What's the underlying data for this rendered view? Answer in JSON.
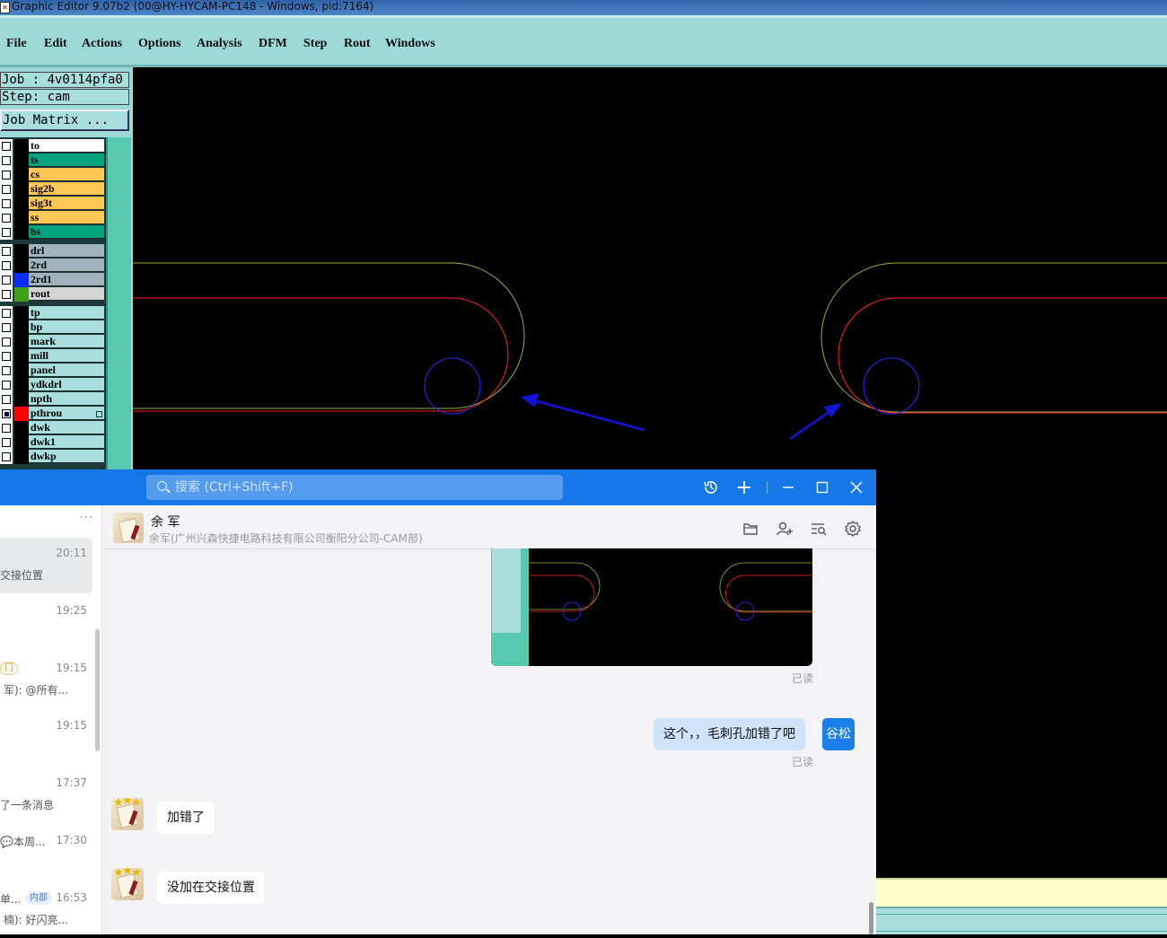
{
  "editor": {
    "title": "Graphic Editor 9.07b2 (00@HY-HYCAM-PC148 - Windows, pid:7164)",
    "menu": [
      "File",
      "Edit",
      "Actions",
      "Options",
      "Analysis",
      "DFM",
      "Step",
      "Rout",
      "Windows"
    ],
    "job_label": "Job : 4v0114pfa0",
    "step_label": "Step: cam",
    "job_matrix_button": "Job Matrix ...",
    "layers": [
      {
        "name": "to",
        "color": "#ffffff",
        "swatch": "#000000"
      },
      {
        "name": "ts",
        "color": "#00a37e",
        "swatch": "#000000"
      },
      {
        "name": "cs",
        "color": "#ffc756",
        "swatch": "#000000"
      },
      {
        "name": "sig2b",
        "color": "#ffc756",
        "swatch": "#000000"
      },
      {
        "name": "sig3t",
        "color": "#ffc756",
        "swatch": "#000000"
      },
      {
        "name": "ss",
        "color": "#ffc756",
        "swatch": "#000000"
      },
      {
        "name": "bs",
        "color": "#00a37e",
        "swatch": "#000000"
      },
      {
        "name": "drl",
        "color": "#9fb4be",
        "swatch": "#000000"
      },
      {
        "name": "2rd",
        "color": "#9fb4be",
        "swatch": "#000000"
      },
      {
        "name": "2rd1",
        "color": "#9fb4be",
        "swatch": "#0b2bff"
      },
      {
        "name": "rout",
        "color": "#d4d4d4",
        "swatch": "#3fa015"
      },
      {
        "name": "tp",
        "color": "#a8dedd",
        "swatch": "#000000"
      },
      {
        "name": "bp",
        "color": "#a8dedd",
        "swatch": "#000000"
      },
      {
        "name": "mark",
        "color": "#a8dedd",
        "swatch": "#000000"
      },
      {
        "name": "mill",
        "color": "#a8dedd",
        "swatch": "#000000"
      },
      {
        "name": "panel",
        "color": "#a8dedd",
        "swatch": "#000000"
      },
      {
        "name": "ydkdrl",
        "color": "#a8dedd",
        "swatch": "#000000"
      },
      {
        "name": "npth",
        "color": "#a8dedd",
        "swatch": "#000000"
      },
      {
        "name": "pthrou",
        "color": "#a8dedd",
        "swatch": "#ff0000"
      },
      {
        "name": "dwk",
        "color": "#a8dedd",
        "swatch": "#000000"
      },
      {
        "name": "dwk1",
        "color": "#a8dedd",
        "swatch": "#000000"
      },
      {
        "name": "dwkp",
        "color": "#a8dedd",
        "swatch": "#000000"
      }
    ],
    "colors": {
      "outline_green": "#8fb43a",
      "outline_red": "#ff2020",
      "hole_blue": "#2a2aff",
      "arrow_blue": "#1414d8"
    }
  },
  "chat": {
    "search_placeholder": "搜索 (Ctrl+Shift+F)",
    "contact_name": "余 军",
    "contact_org": "余军(广州兴森快捷电路科技有限公司衡阳分公司-CAM部)",
    "list_more": "···",
    "conversations": [
      {
        "time": "20:11",
        "preview": "交接位置",
        "badge": ""
      },
      {
        "time": "19:25",
        "preview": "",
        "badge": ""
      },
      {
        "time": "19:15",
        "preview": "军): @所有...",
        "badge": "门"
      },
      {
        "time": "19:15",
        "preview": "",
        "badge": ""
      },
      {
        "time": "17:37",
        "preview": "了一条消息",
        "badge": ""
      },
      {
        "time": "17:30",
        "preview": "💬本周...",
        "badge": ""
      },
      {
        "time": "16:53",
        "preview": "楠): 好闪亮...",
        "badge": "内部",
        "title": "单..."
      }
    ],
    "messages": [
      {
        "from": "me",
        "type": "image",
        "status": "已读"
      },
      {
        "from": "me",
        "type": "text",
        "text": "这个，，毛刺孔加错了吧",
        "status": "已读",
        "avatar_text": "谷松"
      },
      {
        "from": "them",
        "type": "text",
        "text": "加错了"
      },
      {
        "from": "them",
        "type": "text",
        "text": "没加在交接位置"
      }
    ],
    "colors": {
      "header_blue": "#1677e8",
      "my_bubble": "#cfe4fb",
      "their_bubble": "#ffffff"
    }
  }
}
